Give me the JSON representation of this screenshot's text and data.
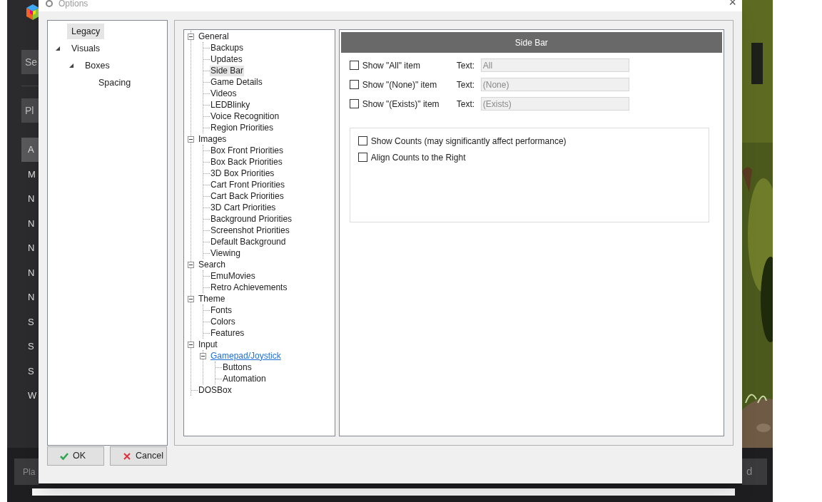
{
  "background_app": {
    "sidebar_buttons": [
      {
        "label": "Se",
        "selected": false
      },
      {
        "label": "Pl",
        "selected": false
      }
    ],
    "sidebar_items": [
      {
        "label": "A",
        "selected": true
      },
      {
        "label": "M",
        "selected": false
      },
      {
        "label": "N",
        "selected": false
      },
      {
        "label": "N",
        "selected": false
      },
      {
        "label": "N",
        "selected": false
      },
      {
        "label": "N",
        "selected": false
      },
      {
        "label": "N",
        "selected": false
      },
      {
        "label": "S",
        "selected": false
      },
      {
        "label": "S",
        "selected": false
      },
      {
        "label": "S",
        "selected": false
      },
      {
        "label": "W",
        "selected": false
      }
    ],
    "bottom_buttons": [
      "Pla",
      "d"
    ]
  },
  "window": {
    "title": "Options",
    "close": "×"
  },
  "legacy_tree": [
    {
      "label": "Legacy",
      "selected": true
    },
    {
      "label": "Visuals",
      "selected": false,
      "expanded": true,
      "children": [
        {
          "label": "Boxes",
          "selected": false,
          "expanded": true,
          "children": [
            {
              "label": "Spacing",
              "selected": false
            }
          ]
        }
      ]
    }
  ],
  "options_tree": [
    {
      "label": "General",
      "selected": false,
      "expanded": true,
      "children": [
        {
          "label": "Backups",
          "selected": false
        },
        {
          "label": "Updates",
          "selected": false
        },
        {
          "label": "Side Bar",
          "selected": true
        },
        {
          "label": "Game Details",
          "selected": false
        },
        {
          "label": "Videos",
          "selected": false
        },
        {
          "label": "LEDBlinky",
          "selected": false
        },
        {
          "label": "Voice Recognition",
          "selected": false
        },
        {
          "label": "Region Priorities",
          "selected": false
        }
      ]
    },
    {
      "label": "Images",
      "selected": false,
      "expanded": true,
      "children": [
        {
          "label": "Box Front Priorities",
          "selected": false
        },
        {
          "label": "Box Back Priorities",
          "selected": false
        },
        {
          "label": "3D Box Priorities",
          "selected": false
        },
        {
          "label": "Cart Front Priorities",
          "selected": false
        },
        {
          "label": "Cart Back Priorities",
          "selected": false
        },
        {
          "label": "3D Cart Priorities",
          "selected": false
        },
        {
          "label": "Background Priorities",
          "selected": false
        },
        {
          "label": "Screenshot Priorities",
          "selected": false
        },
        {
          "label": "Default Background",
          "selected": false
        },
        {
          "label": "Viewing",
          "selected": false
        }
      ]
    },
    {
      "label": "Search",
      "selected": false,
      "expanded": true,
      "children": [
        {
          "label": "EmuMovies",
          "selected": false
        },
        {
          "label": "Retro Achievements",
          "selected": false
        }
      ]
    },
    {
      "label": "Theme",
      "selected": false,
      "expanded": true,
      "children": [
        {
          "label": "Fonts",
          "selected": false
        },
        {
          "label": "Colors",
          "selected": false
        },
        {
          "label": "Features",
          "selected": false
        }
      ]
    },
    {
      "label": "Input",
      "selected": false,
      "expanded": true,
      "children": [
        {
          "label": "Gamepad/Joystick",
          "selected": false,
          "hovered": true,
          "expanded": true,
          "children": [
            {
              "label": "Buttons",
              "selected": false
            },
            {
              "label": "Automation",
              "selected": false
            }
          ]
        }
      ]
    },
    {
      "label": "DOSBox",
      "selected": false
    }
  ],
  "panel": {
    "title": "Side Bar",
    "item_rows": [
      {
        "label": "Show \"All\" item",
        "checked": false,
        "text_label": "Text:",
        "value": "All",
        "disabled": true
      },
      {
        "label": "Show \"(None)\" item",
        "checked": false,
        "text_label": "Text:",
        "value": "(None)",
        "disabled": true
      },
      {
        "label": "Show \"(Exists)\" item",
        "checked": false,
        "text_label": "Text:",
        "value": "(Exists)",
        "disabled": true
      }
    ],
    "count_options": [
      {
        "label": "Show Counts (may significantly affect performance)",
        "checked": false
      },
      {
        "label": "Align Counts to the Right",
        "checked": false
      }
    ]
  },
  "buttons": [
    {
      "label": "OK",
      "kind": "ok"
    },
    {
      "label": "Cancel",
      "kind": "cancel"
    }
  ]
}
